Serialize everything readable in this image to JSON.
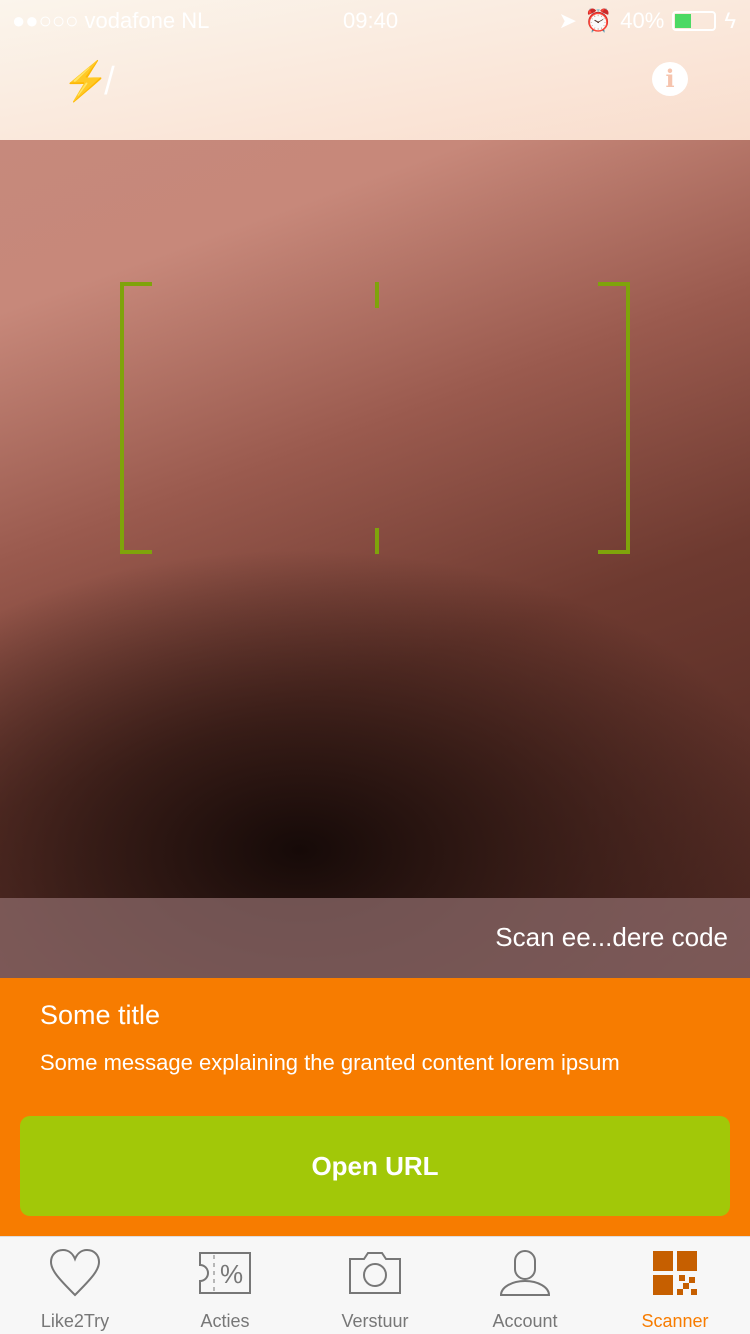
{
  "status": {
    "carrier": "●●○○○ vodafone NL",
    "time": "09:40",
    "battery": "40%",
    "battery_level": 0.4
  },
  "scanner": {
    "hint": "Scan ee...dere code"
  },
  "panel": {
    "title": "Some title",
    "message": "Some message explaining the granted content lorem ipsum",
    "button": "Open URL"
  },
  "tabs": [
    {
      "label": "Like2Try"
    },
    {
      "label": "Acties"
    },
    {
      "label": "Verstuur"
    },
    {
      "label": "Account"
    },
    {
      "label": "Scanner",
      "active": true
    }
  ],
  "colors": {
    "accent": "#f77c00",
    "button": "#a2c808",
    "frame": "#7fa30b"
  }
}
